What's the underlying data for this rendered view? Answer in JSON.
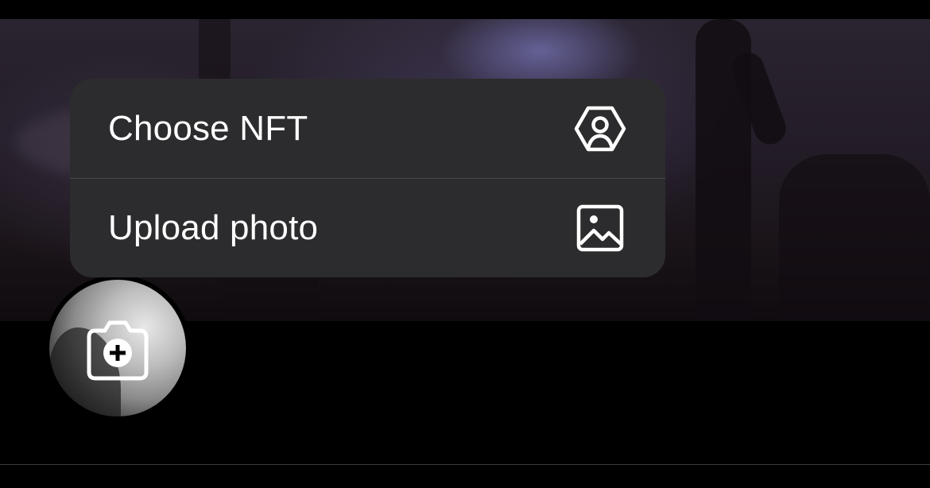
{
  "menu": {
    "items": [
      {
        "label": "Choose NFT",
        "icon": "hexagon-person-icon"
      },
      {
        "label": "Upload photo",
        "icon": "photo-icon"
      }
    ]
  },
  "profile": {
    "avatar_action_icon": "camera-plus-icon"
  },
  "colors": {
    "menu_background": "#2c2c2e",
    "menu_separator": "#48484a",
    "text": "#ffffff",
    "background": "#000000"
  }
}
